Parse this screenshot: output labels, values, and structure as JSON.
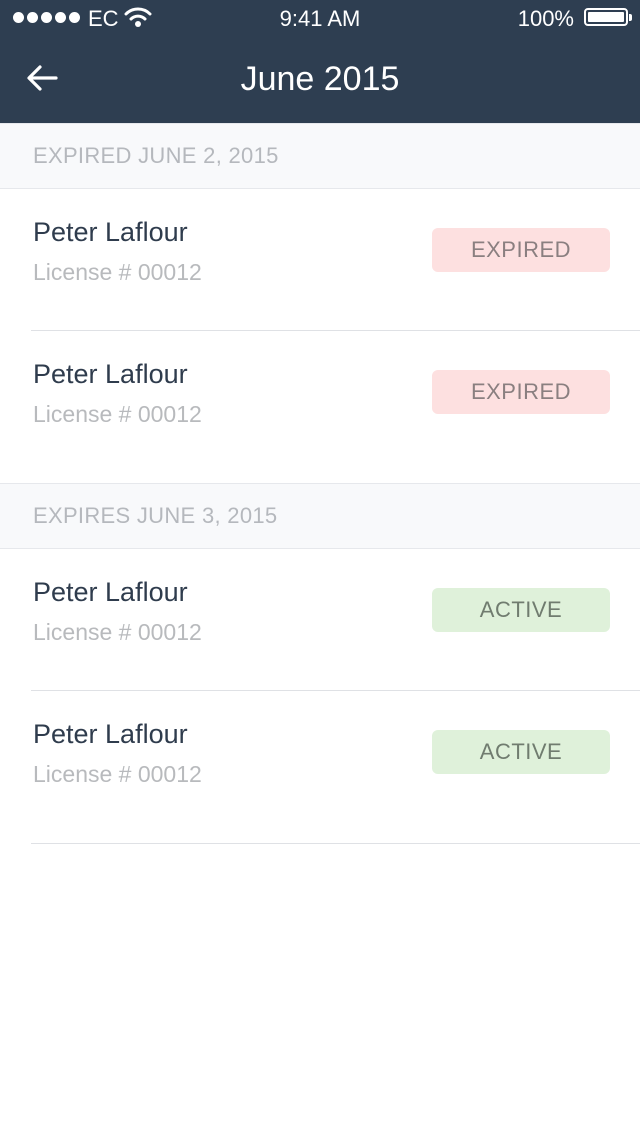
{
  "status_bar": {
    "carrier": "EC",
    "time": "9:41 AM",
    "battery": "100%"
  },
  "nav": {
    "title": "June 2015",
    "back_icon": "back-arrow-icon"
  },
  "sections": [
    {
      "header": "EXPIRED JUNE 2, 2015",
      "rows": [
        {
          "name": "Peter Laflour",
          "license": "License # 00012",
          "status": "EXPIRED"
        },
        {
          "name": "Peter Laflour",
          "license": "License # 00012",
          "status": "EXPIRED"
        }
      ]
    },
    {
      "header": "EXPIRES JUNE 3, 2015",
      "rows": [
        {
          "name": "Peter Laflour",
          "license": "License # 00012",
          "status": "ACTIVE"
        },
        {
          "name": "Peter Laflour",
          "license": "License # 00012",
          "status": "ACTIVE"
        }
      ]
    }
  ],
  "colors": {
    "header_bg": "#2e3e51",
    "expired_bg": "#fde0e0",
    "active_bg": "#dff1da"
  }
}
